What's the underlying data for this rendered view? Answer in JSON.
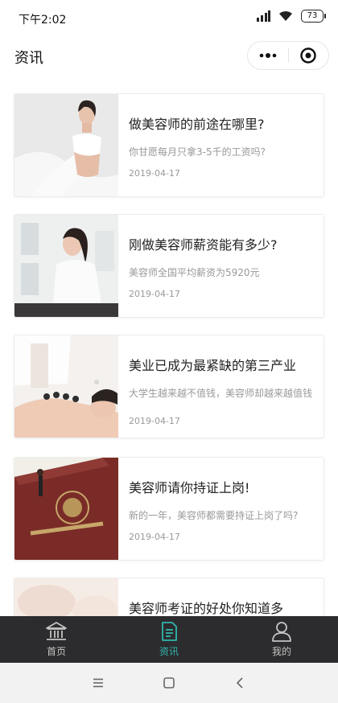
{
  "status_bar": {
    "time": "下午2:02",
    "battery": "73"
  },
  "nav": {
    "title": "资讯"
  },
  "articles": [
    {
      "title": "做美容师的前途在哪里?",
      "desc": "你甘愿每月只拿3-5千的工资吗?",
      "date": "2019-04-17"
    },
    {
      "title": "刚做美容师薪资能有多少?",
      "desc": "美容师全国平均薪资为5920元",
      "date": "2019-04-17"
    },
    {
      "title": "美业已成为最紧缺的第三产业",
      "desc": "大学生越来越不值钱，美容师却越来越值钱",
      "date": "2019-04-17"
    },
    {
      "title": "美容师请你持证上岗!",
      "desc": "新的一年，美容师都需要持证上岗了吗?",
      "date": "2019-04-17"
    },
    {
      "title": "美容师考证的好处你知道多",
      "desc": "",
      "date": ""
    }
  ],
  "tabs": [
    {
      "label": "首页",
      "icon": "home-icon",
      "active": false
    },
    {
      "label": "资讯",
      "icon": "news-icon",
      "active": true
    },
    {
      "label": "我的",
      "icon": "user-icon",
      "active": false
    }
  ],
  "colors": {
    "accent": "#2fb6ad",
    "tabbar_bg": "#2c2c2e"
  }
}
